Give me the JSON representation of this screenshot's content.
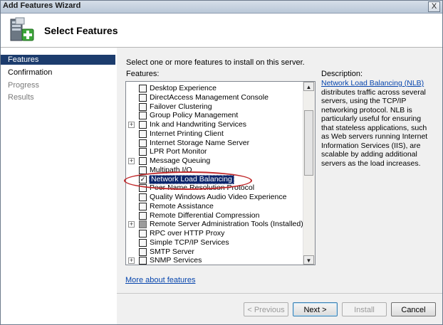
{
  "window": {
    "title": "Add Features Wizard",
    "close_label": "X"
  },
  "header": {
    "heading": "Select Features"
  },
  "nav": [
    {
      "label": "Features",
      "state": "selected"
    },
    {
      "label": "Confirmation",
      "state": "normal"
    },
    {
      "label": "Progress",
      "state": "disabled"
    },
    {
      "label": "Results",
      "state": "disabled"
    }
  ],
  "content": {
    "instruction": "Select one or more features to install on this server.",
    "features_label": "Features:",
    "description_label": "Description:",
    "description_link": "Network Load Balancing (NLB)",
    "description_text": "distributes traffic across several servers, using the TCP/IP networking protocol. NLB is particularly useful for ensuring that stateless applications, such as Web servers running Internet Information Services (IIS), are scalable by adding additional servers as the load increases.",
    "more_link": "More about features"
  },
  "features": [
    {
      "label": "Desktop Experience",
      "expandable": false,
      "checked": false,
      "state": "normal"
    },
    {
      "label": "DirectAccess Management Console",
      "expandable": false,
      "checked": false,
      "state": "normal"
    },
    {
      "label": "Failover Clustering",
      "expandable": false,
      "checked": false,
      "state": "normal"
    },
    {
      "label": "Group Policy Management",
      "expandable": false,
      "checked": false,
      "state": "normal"
    },
    {
      "label": "Ink and Handwriting Services",
      "expandable": true,
      "checked": false,
      "state": "normal"
    },
    {
      "label": "Internet Printing Client",
      "expandable": false,
      "checked": false,
      "state": "normal"
    },
    {
      "label": "Internet Storage Name Server",
      "expandable": false,
      "checked": false,
      "state": "normal"
    },
    {
      "label": "LPR Port Monitor",
      "expandable": false,
      "checked": false,
      "state": "normal"
    },
    {
      "label": "Message Queuing",
      "expandable": true,
      "checked": false,
      "state": "normal"
    },
    {
      "label": "Multipath I/O",
      "expandable": false,
      "checked": false,
      "state": "normal"
    },
    {
      "label": "Network Load Balancing",
      "expandable": false,
      "checked": true,
      "state": "selected"
    },
    {
      "label": "Peer Name Resolution Protocol",
      "expandable": false,
      "checked": false,
      "state": "normal"
    },
    {
      "label": "Quality Windows Audio Video Experience",
      "expandable": false,
      "checked": false,
      "state": "normal"
    },
    {
      "label": "Remote Assistance",
      "expandable": false,
      "checked": false,
      "state": "normal"
    },
    {
      "label": "Remote Differential Compression",
      "expandable": false,
      "checked": false,
      "state": "normal"
    },
    {
      "label": "Remote Server Administration Tools  (Installed)",
      "expandable": true,
      "checked": false,
      "state": "partial"
    },
    {
      "label": "RPC over HTTP Proxy",
      "expandable": false,
      "checked": false,
      "state": "normal"
    },
    {
      "label": "Simple TCP/IP Services",
      "expandable": false,
      "checked": false,
      "state": "normal"
    },
    {
      "label": "SMTP Server",
      "expandable": false,
      "checked": false,
      "state": "normal"
    },
    {
      "label": "SNMP Services",
      "expandable": true,
      "checked": false,
      "state": "normal"
    }
  ],
  "scrollbar": {
    "up_arrow": "▲",
    "down_arrow": "▼"
  },
  "buttons": {
    "previous": "< Previous",
    "next": "Next >",
    "install": "Install",
    "cancel": "Cancel"
  },
  "colors": {
    "nav_selected": "#1c3c6d",
    "selection": "#0a246a",
    "highlight_ring": "#c0282a",
    "link": "#0645ad"
  }
}
